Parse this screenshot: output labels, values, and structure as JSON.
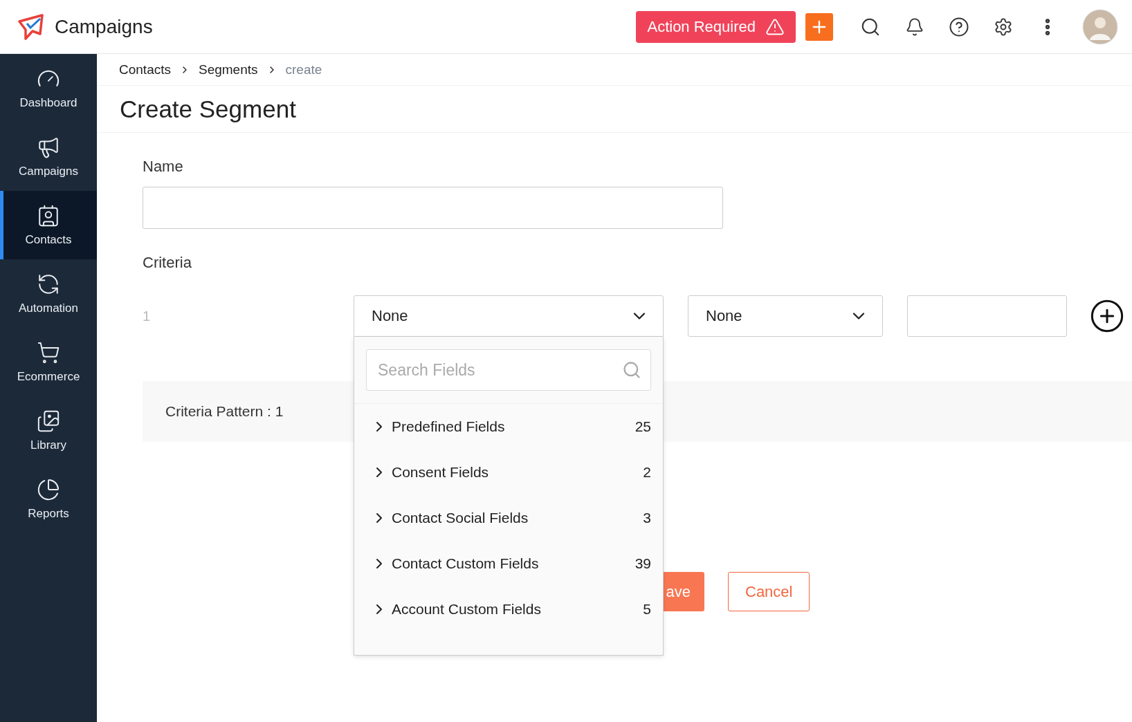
{
  "app": {
    "name": "Campaigns"
  },
  "header": {
    "action_button": "Action Required"
  },
  "sidebar": {
    "items": [
      {
        "label": "Dashboard",
        "selected": false
      },
      {
        "label": "Campaigns",
        "selected": false
      },
      {
        "label": "Contacts",
        "selected": true
      },
      {
        "label": "Automation",
        "selected": false
      },
      {
        "label": "Ecommerce",
        "selected": false
      },
      {
        "label": "Library",
        "selected": false
      },
      {
        "label": "Reports",
        "selected": false
      }
    ]
  },
  "breadcrumb": [
    {
      "label": "Contacts",
      "current": false
    },
    {
      "label": "Segments",
      "current": false
    },
    {
      "label": "create",
      "current": true
    }
  ],
  "page_title": "Create Segment",
  "form": {
    "name_label": "Name",
    "criteria_label": "Criteria",
    "criteria_rows": [
      {
        "number": "1",
        "field": "None",
        "operator": "None"
      }
    ],
    "criteria_pattern": "Criteria Pattern : 1"
  },
  "field_dropdown": {
    "search_placeholder": "Search Fields",
    "groups": [
      {
        "label": "Predefined Fields",
        "count": "25"
      },
      {
        "label": "Consent Fields",
        "count": "2"
      },
      {
        "label": "Contact Social Fields",
        "count": "3"
      },
      {
        "label": "Contact Custom Fields",
        "count": "39"
      },
      {
        "label": "Account Custom Fields",
        "count": "5"
      }
    ]
  },
  "buttons": [
    {
      "label": "ave",
      "kind": "primary"
    },
    {
      "label": "Cancel",
      "kind": "secondary"
    }
  ]
}
